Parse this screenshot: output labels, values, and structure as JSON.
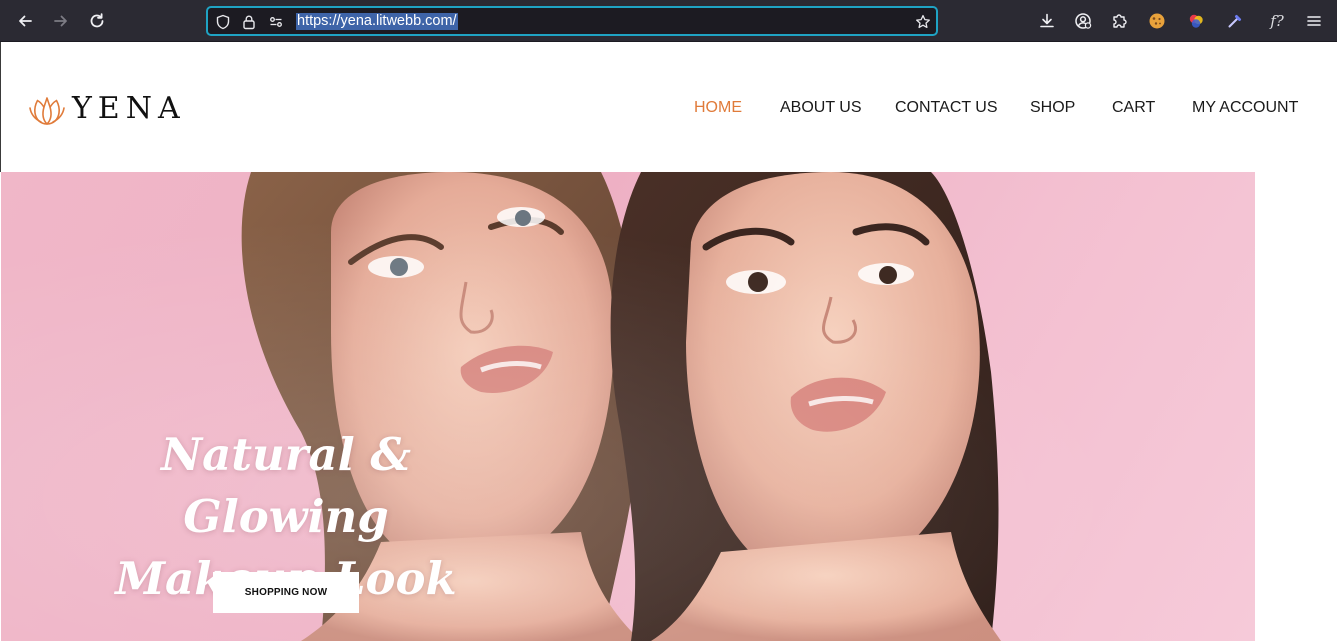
{
  "browser": {
    "url": "https://yena.litwebb.com/",
    "icons": {
      "back": "arrow-left-icon",
      "forward": "arrow-right-icon",
      "reload": "reload-icon",
      "shield": "shield-icon",
      "lock": "lock-icon",
      "permissions": "permissions-icon",
      "bookmark": "star-icon",
      "downloads": "download-icon",
      "account": "account-icon",
      "extensions": "puzzle-icon",
      "menu": "hamburger-icon"
    },
    "extension_label": "f?",
    "colors": {
      "chrome": "#2b2a33",
      "url_field": "#1c1b22",
      "focus_ring": "#1fa3c4",
      "selection": "#3e64a8"
    }
  },
  "site": {
    "brand": "YENA",
    "nav": [
      {
        "label": "HOME",
        "active": true
      },
      {
        "label": "ABOUT US",
        "active": false
      },
      {
        "label": "CONTACT US",
        "active": false
      },
      {
        "label": "SHOP",
        "active": false
      },
      {
        "label": "CART",
        "active": false
      },
      {
        "label": "MY ACCOUNT",
        "active": false
      }
    ],
    "colors": {
      "accent": "#e07b3a",
      "text": "#1a1a1a",
      "hero_bg": "#f0b7c8"
    }
  },
  "hero": {
    "headline_line1": "Natural & Glowing",
    "headline_line2": "Makeup Look",
    "button_label": "SHOPPING NOW"
  }
}
